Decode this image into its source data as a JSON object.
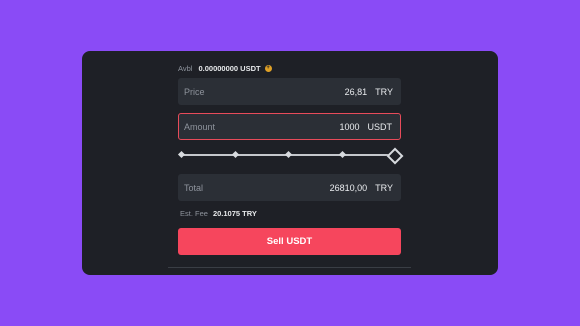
{
  "balance": {
    "label": "Avbl",
    "value": "0.00000000 USDT"
  },
  "price": {
    "label": "Price",
    "value": "26,81",
    "unit": "TRY"
  },
  "amount": {
    "label": "Amount",
    "value": "1000",
    "unit": "USDT"
  },
  "slider": {
    "level": 1.0
  },
  "total": {
    "label": "Total",
    "value": "26810,00",
    "unit": "TRY"
  },
  "fee": {
    "label": "Est. Fee",
    "value": "20.1075 TRY"
  },
  "sell_button": {
    "label": "Sell USDT"
  },
  "colors": {
    "sell": "#f6465d",
    "background": "#8a4bf6",
    "card": "#1e2026",
    "field": "#2b2f36",
    "accent": "#e0a126"
  }
}
